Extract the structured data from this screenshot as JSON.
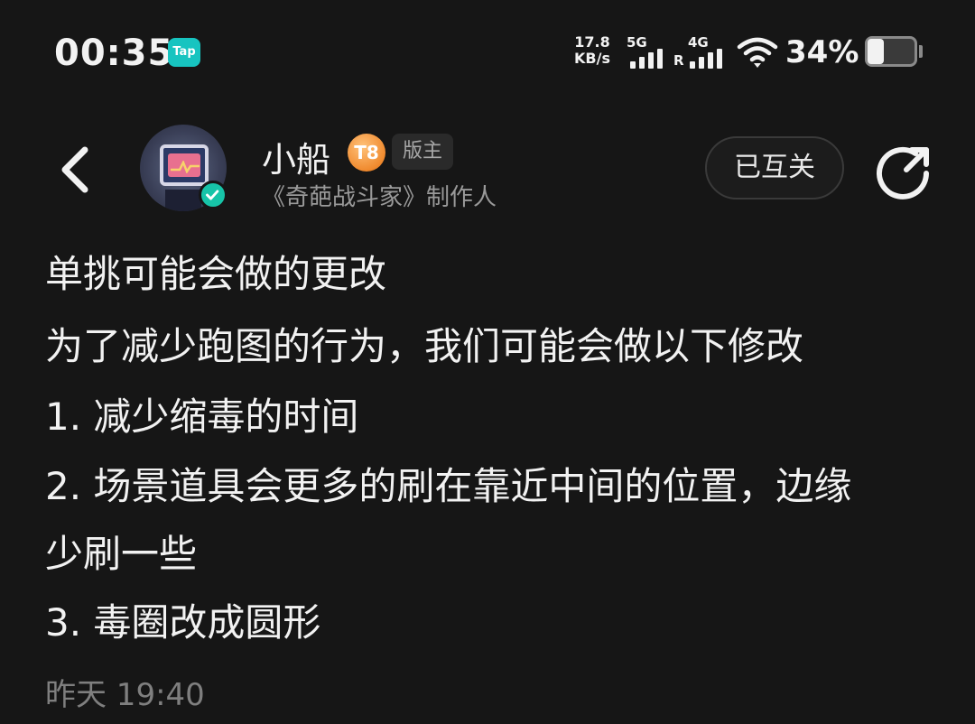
{
  "status_bar": {
    "time": "00:35",
    "tap_badge": "Tap",
    "net_speed_value": "17.8",
    "net_speed_unit": "KB/s",
    "sim1_label": "5G",
    "sim2_label": "4G",
    "sim2_roaming": "R",
    "battery_percent": "34%",
    "battery_level": 0.34
  },
  "header": {
    "username": "小船",
    "level_badge": "T8",
    "role_tag": "版主",
    "subtitle": "《奇葩战斗家》制作人",
    "follow_button": "已互关"
  },
  "post": {
    "title": "单挑可能会做的更改",
    "lines": [
      "为了减少跑图的行为，我们可能会做以下修改",
      "1. 减少缩毒的时间",
      "2. 场景道具会更多的刷在靠近中间的位置，边缘",
      "少刷一些",
      "3. 毒圈改成圆形"
    ],
    "timestamp": "昨天 19:40"
  },
  "colors": {
    "background": "#161616",
    "accent_teal": "#17c4c0",
    "level_orange": "#f08a2e"
  },
  "icons": [
    "back-arrow-icon",
    "share-icon",
    "verified-icon",
    "wifi-icon",
    "signal-icon",
    "battery-icon"
  ]
}
